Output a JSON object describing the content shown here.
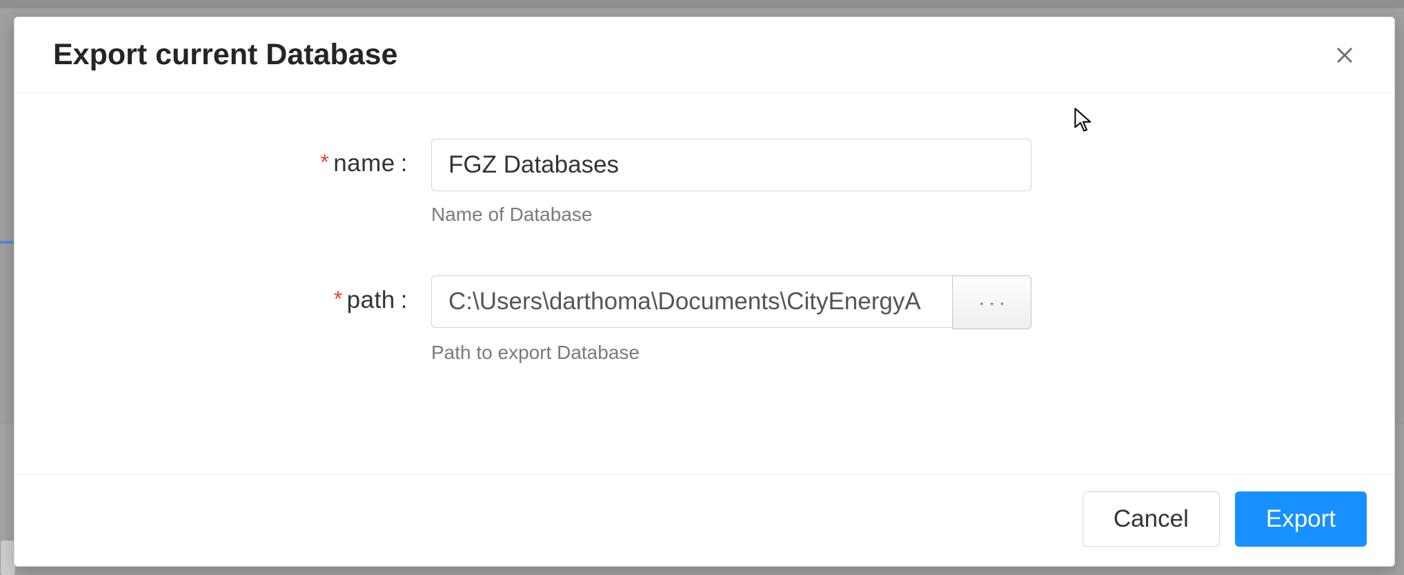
{
  "modal": {
    "title": "Export current Database",
    "close_icon": "close-icon"
  },
  "form": {
    "name": {
      "label": "name",
      "value": "FGZ Databases",
      "helper": "Name of Database"
    },
    "path": {
      "label": "path",
      "value": "C:\\Users\\darthoma\\Documents\\CityEnergyA",
      "browse_label": "···",
      "helper": "Path to export Database"
    }
  },
  "footer": {
    "cancel": "Cancel",
    "export": "Export"
  }
}
